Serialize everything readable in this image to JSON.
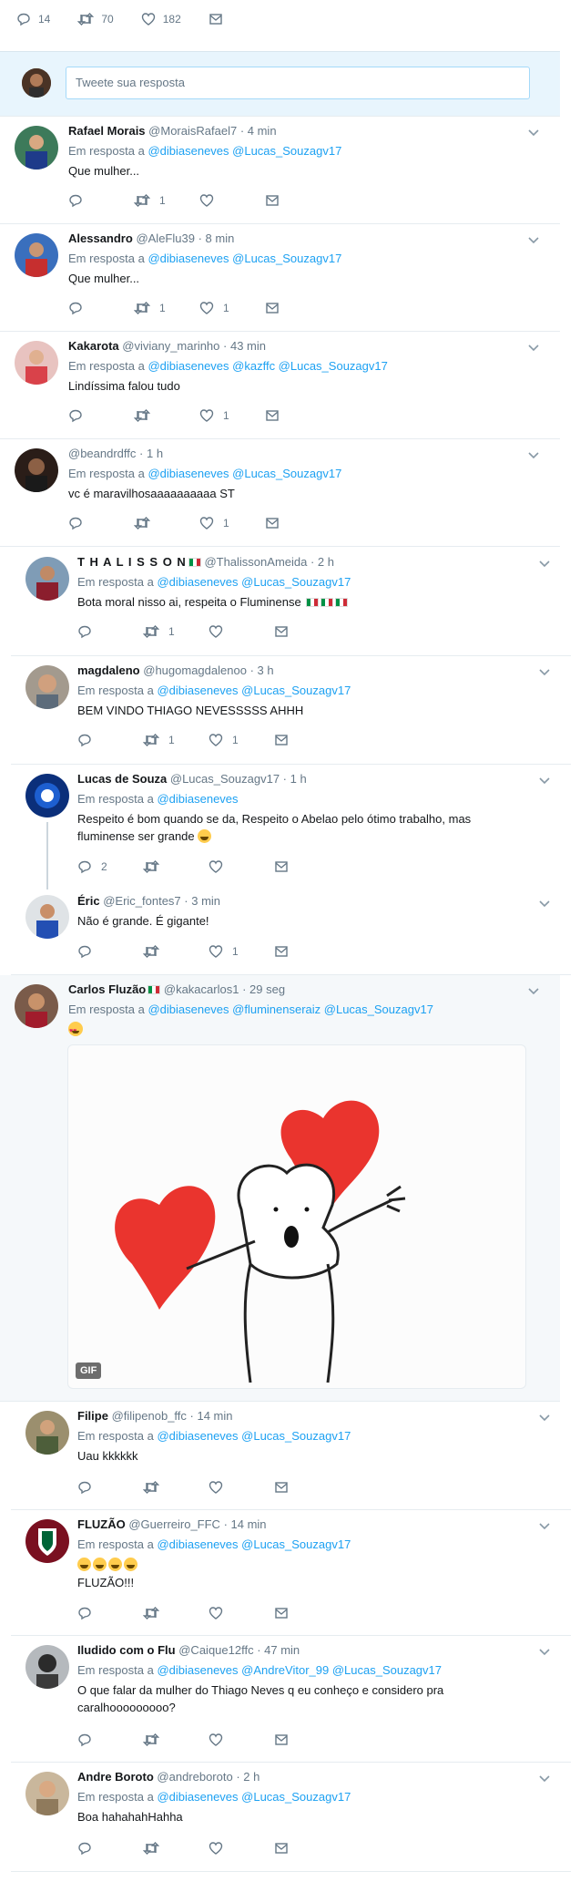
{
  "top_actions": {
    "replies": "14",
    "retweets": "70",
    "likes": "182"
  },
  "reply_box": {
    "placeholder": "Tweete sua resposta"
  },
  "tweets": [
    {
      "name": "Rafael Morais",
      "handle": "@MoraisRafael7",
      "time": "· 4 min",
      "replying_prefix": "Em resposta a",
      "mentions": "@dibiaseneves @Lucas_Souzagv17",
      "text": "Que mulher...",
      "replies": "",
      "retweets": "1",
      "likes": ""
    },
    {
      "name": "Alessandro",
      "handle": "@AleFlu39",
      "time": "· 8 min",
      "replying_prefix": "Em resposta a",
      "mentions": "@dibiaseneves @Lucas_Souzagv17",
      "text": "Que mulher...",
      "replies": "",
      "retweets": "1",
      "likes": "1"
    },
    {
      "name": "Kakarota",
      "handle": "@viviany_marinho",
      "time": "· 43 min",
      "replying_prefix": "Em resposta a",
      "mentions": "@dibiaseneves @kazffc @Lucas_Souzagv17",
      "text": "Lindíssima falou tudo",
      "replies": "",
      "retweets": "",
      "likes": "1"
    },
    {
      "name": "",
      "handle": "@beandrdffc",
      "time": "· 1 h",
      "replying_prefix": "Em resposta a",
      "mentions": "@dibiaseneves @Lucas_Souzagv17",
      "text": "vc é maravilhosaaaaaaaaaa ST",
      "replies": "",
      "retweets": "",
      "likes": "1"
    },
    {
      "name": "T H A L I S S O N",
      "handle": "@ThalissonAmeida",
      "time": "· 2 h",
      "replying_prefix": "Em resposta a",
      "mentions": "@dibiaseneves @Lucas_Souzagv17",
      "text": "Bota moral nisso ai, respeita o Fluminense",
      "replies": "",
      "retweets": "1",
      "likes": ""
    },
    {
      "name": "magdaleno",
      "handle": "@hugomagdalenoo",
      "time": "· 3 h",
      "replying_prefix": "Em resposta a",
      "mentions": "@dibiaseneves @Lucas_Souzagv17",
      "text": "BEM VINDO THIAGO NEVESSSSS AHHH",
      "replies": "",
      "retweets": "1",
      "likes": "1"
    },
    {
      "name": "Lucas de Souza",
      "handle": "@Lucas_Souzagv17",
      "time": "· 1 h",
      "replying_prefix": "Em resposta a",
      "mentions": "@dibiaseneves",
      "text": "Respeito é bom quando se da, Respeito o Abelao pelo ótimo trabalho, mas fluminense ser grande",
      "replies": "2",
      "retweets": "",
      "likes": ""
    },
    {
      "name": "Éric",
      "handle": "@Eric_fontes7",
      "time": "· 3 min",
      "replying_prefix": "",
      "mentions": "",
      "text": "Não é grande. É gigante!",
      "replies": "",
      "retweets": "",
      "likes": "1"
    },
    {
      "name": "Carlos Fluzão",
      "handle": "@kakacarlos1",
      "time": "· 29 seg",
      "replying_prefix": "Em resposta a",
      "mentions": "@dibiaseneves @fluminenseraiz @Lucas_Souzagv17",
      "text": "",
      "replies": "",
      "retweets": "",
      "likes": "",
      "gif_label": "GIF"
    },
    {
      "name": "Filipe",
      "handle": "@filipenob_ffc",
      "time": "· 14 min",
      "replying_prefix": "Em resposta a",
      "mentions": "@dibiaseneves @Lucas_Souzagv17",
      "text": "Uau kkkkkk",
      "replies": "",
      "retweets": "",
      "likes": ""
    },
    {
      "name": "FLUZÃO",
      "handle": "@Guerreiro_FFC",
      "time": "· 14 min",
      "replying_prefix": "Em resposta a",
      "mentions": "@dibiaseneves @Lucas_Souzagv17",
      "text": "FLUZÃO!!!",
      "replies": "",
      "retweets": "",
      "likes": ""
    },
    {
      "name": "Iludido com o Flu",
      "handle": "@Caique12ffc",
      "time": "· 47 min",
      "replying_prefix": "Em resposta a",
      "mentions": "@dibiaseneves @AndreVitor_99 @Lucas_Souzagv17",
      "text": "O que falar da mulher do Thiago Neves q eu conheço e considero pra caralhooooooooo?",
      "replies": "",
      "retweets": "",
      "likes": ""
    },
    {
      "name": "Andre Boroto",
      "handle": "@andreboroto",
      "time": "· 2 h",
      "replying_prefix": "Em resposta a",
      "mentions": "@dibiaseneves @Lucas_Souzagv17",
      "text": "Boa hahahahHahha",
      "replies": "",
      "retweets": "",
      "likes": ""
    }
  ],
  "colors": {
    "accent": "#1da1f2",
    "muted": "#657786",
    "reply_bg": "#e8f5fd"
  }
}
